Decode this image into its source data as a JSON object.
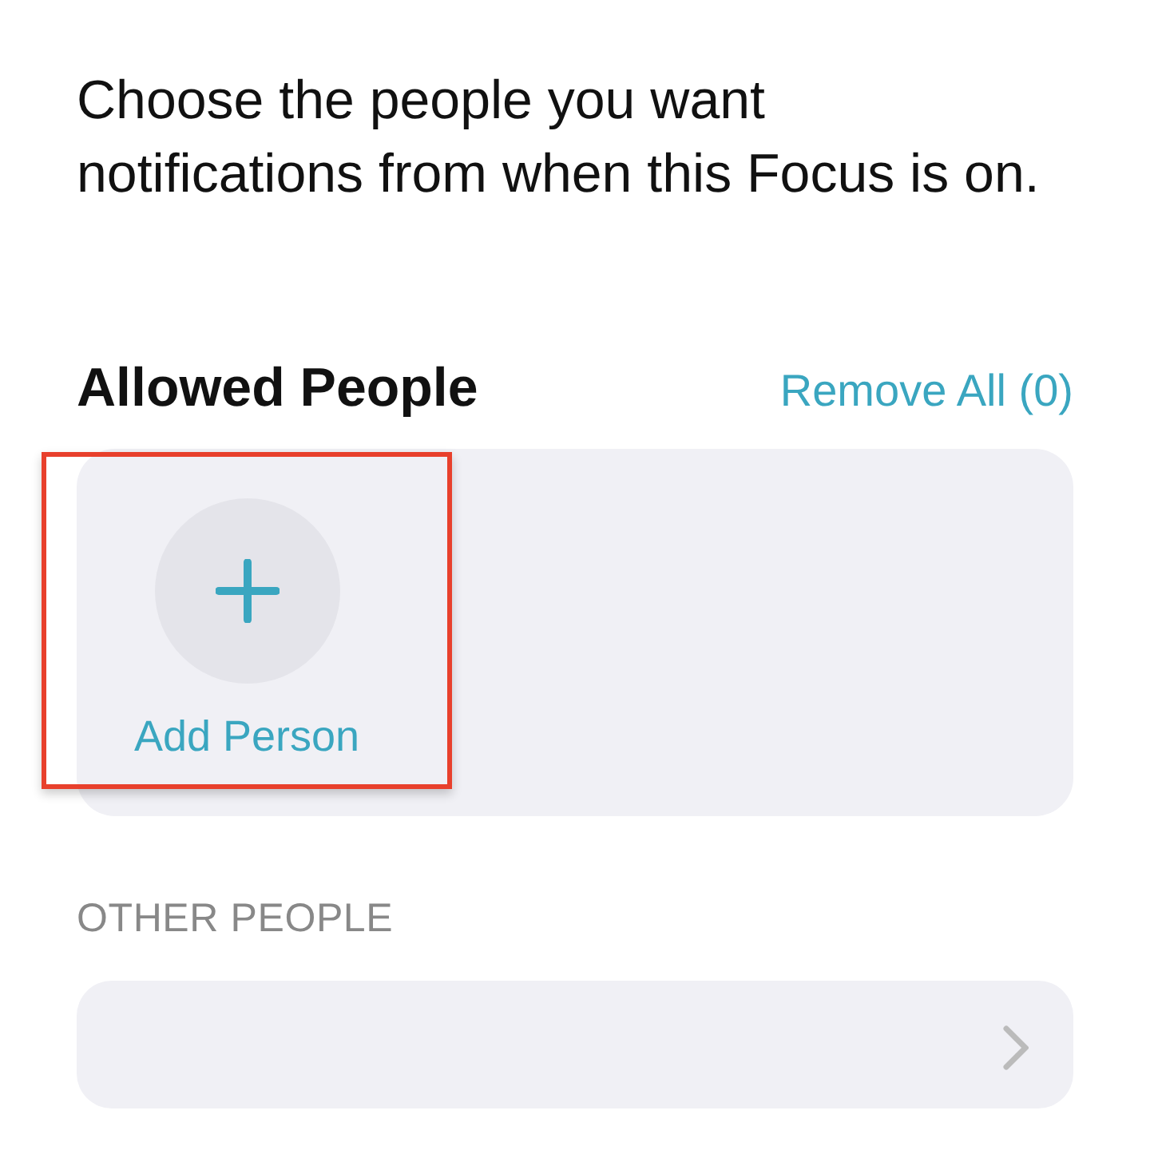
{
  "description": "Choose the people you want notifications from when this Focus is on.",
  "allowed_people": {
    "title": "Allowed People",
    "action": "Remove All (0)",
    "add_button": {
      "label": "Add Person",
      "highlighted": true
    }
  },
  "other_people": {
    "header": "OTHER PEOPLE"
  }
}
